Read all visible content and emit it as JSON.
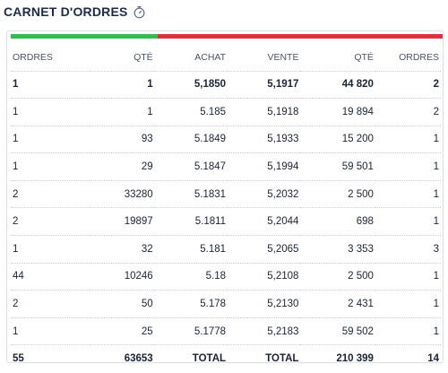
{
  "header": {
    "title": "CARNET D'ORDRES",
    "icon": "stopwatch-icon"
  },
  "colors": {
    "buy": "#2ebd4e",
    "sell": "#e03140",
    "title": "#1b2a4e"
  },
  "columns": [
    "ORDRES",
    "QTÉ",
    "ACHAT",
    "VENTE",
    "QTÉ",
    "ORDRES"
  ],
  "rows": [
    [
      "1",
      "1",
      "5,1850",
      "5,1917",
      "44 820",
      "2"
    ],
    [
      "1",
      "1",
      "5.185",
      "5,1918",
      "19 894",
      "2"
    ],
    [
      "1",
      "93",
      "5.1849",
      "5,1933",
      "15 200",
      "1"
    ],
    [
      "1",
      "29",
      "5.1847",
      "5,1994",
      "59 501",
      "1"
    ],
    [
      "2",
      "33280",
      "5.1831",
      "5,2032",
      "2 500",
      "1"
    ],
    [
      "2",
      "19897",
      "5.1811",
      "5,2044",
      "698",
      "1"
    ],
    [
      "1",
      "32",
      "5.181",
      "5,2065",
      "3 353",
      "3"
    ],
    [
      "44",
      "10246",
      "5.18",
      "5,2108",
      "2 500",
      "1"
    ],
    [
      "2",
      "50",
      "5.178",
      "5,2130",
      "2 431",
      "1"
    ],
    [
      "1",
      "25",
      "5.1778",
      "5,2183",
      "59 502",
      "1"
    ]
  ],
  "totals": [
    "55",
    "63653",
    "TOTAL",
    "TOTAL",
    "210 399",
    "14"
  ]
}
